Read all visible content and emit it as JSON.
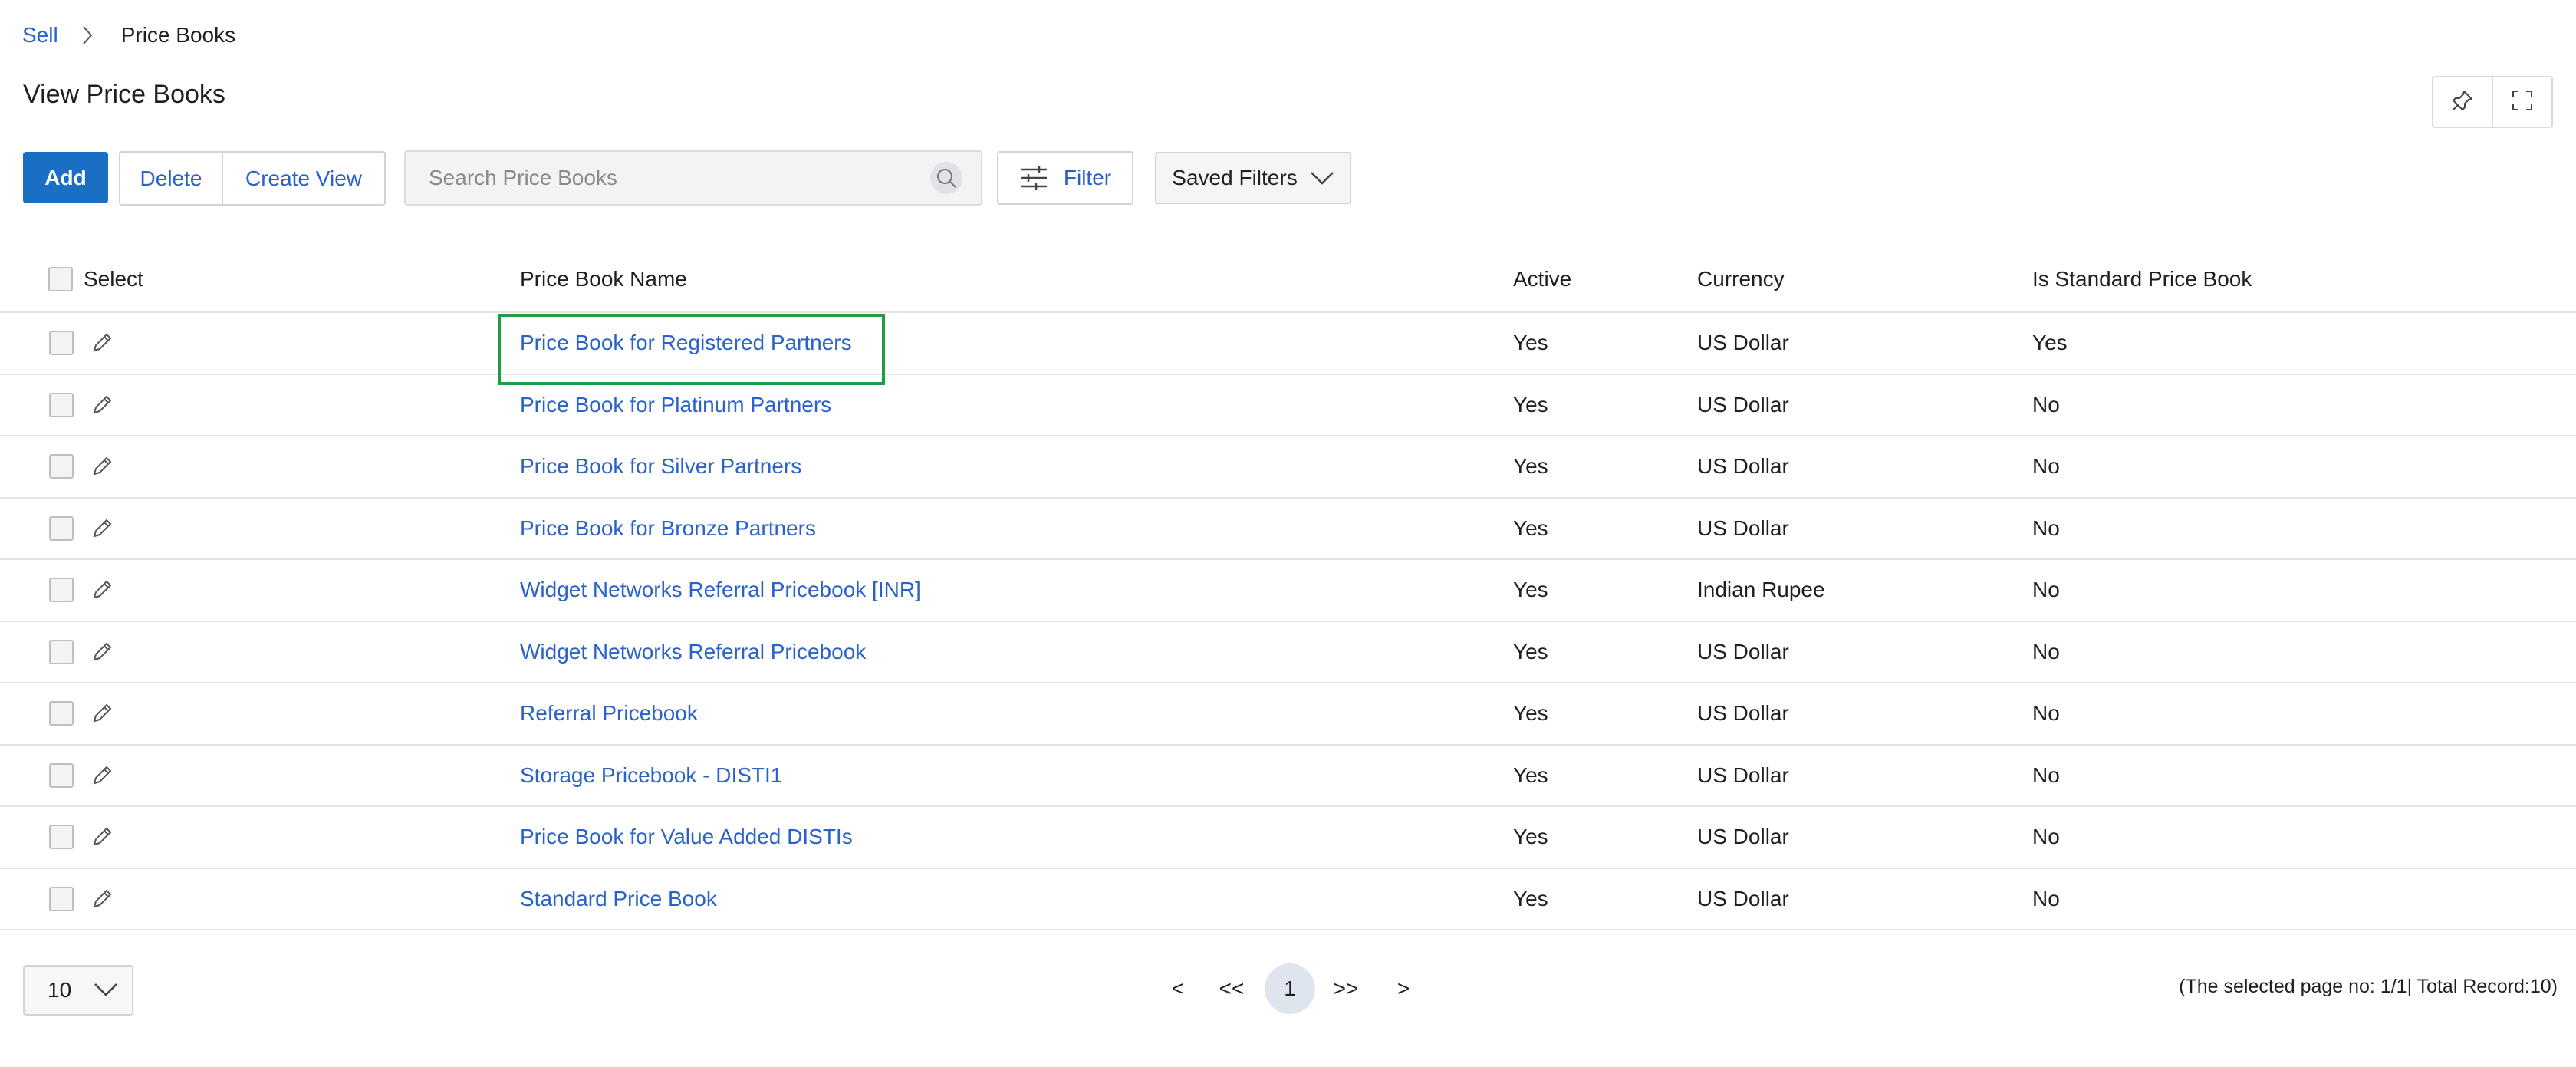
{
  "breadcrumb": {
    "parent": "Sell",
    "current": "Price Books"
  },
  "page_title": "View Price Books",
  "toolbar": {
    "add_label": "Add",
    "delete_label": "Delete",
    "create_view_label": "Create View",
    "search_placeholder": "Search Price Books",
    "filter_label": "Filter",
    "saved_filters_label": "Saved Filters"
  },
  "table": {
    "headers": {
      "select": "Select",
      "name": "Price Book Name",
      "active": "Active",
      "currency": "Currency",
      "standard": "Is Standard Price Book"
    },
    "rows": [
      {
        "name": "Price Book for Registered Partners",
        "active": "Yes",
        "currency": "US Dollar",
        "standard": "Yes"
      },
      {
        "name": "Price Book for Platinum Partners",
        "active": "Yes",
        "currency": "US Dollar",
        "standard": "No"
      },
      {
        "name": "Price Book for Silver Partners",
        "active": "Yes",
        "currency": "US Dollar",
        "standard": "No"
      },
      {
        "name": "Price Book for Bronze Partners",
        "active": "Yes",
        "currency": "US Dollar",
        "standard": "No"
      },
      {
        "name": "Widget Networks Referral Pricebook [INR]",
        "active": "Yes",
        "currency": "Indian Rupee",
        "standard": "No"
      },
      {
        "name": "Widget Networks Referral Pricebook",
        "active": "Yes",
        "currency": "US Dollar",
        "standard": "No"
      },
      {
        "name": "Referral Pricebook",
        "active": "Yes",
        "currency": "US Dollar",
        "standard": "No"
      },
      {
        "name": "Storage Pricebook - DISTI1",
        "active": "Yes",
        "currency": "US Dollar",
        "standard": "No"
      },
      {
        "name": "Price Book for Value Added DISTIs",
        "active": "Yes",
        "currency": "US Dollar",
        "standard": "No"
      },
      {
        "name": "Standard Price Book",
        "active": "Yes",
        "currency": "US Dollar",
        "standard": "No"
      }
    ]
  },
  "pagination": {
    "page_size": "10",
    "prev": "<",
    "first": "<<",
    "current_page": "1",
    "last": ">>",
    "next": ">",
    "record_info": "(The selected page no: 1/1| Total Record:10)"
  },
  "icons": {
    "pin": "pin-icon",
    "expand": "expand-icon",
    "search": "search-icon",
    "filter": "sliders-icon",
    "chevron": "chevron-down-icon",
    "edit": "pencil-icon"
  },
  "colors": {
    "primary": "#1a6fc4",
    "link": "#2a62c9",
    "highlight": "#1aa043"
  }
}
